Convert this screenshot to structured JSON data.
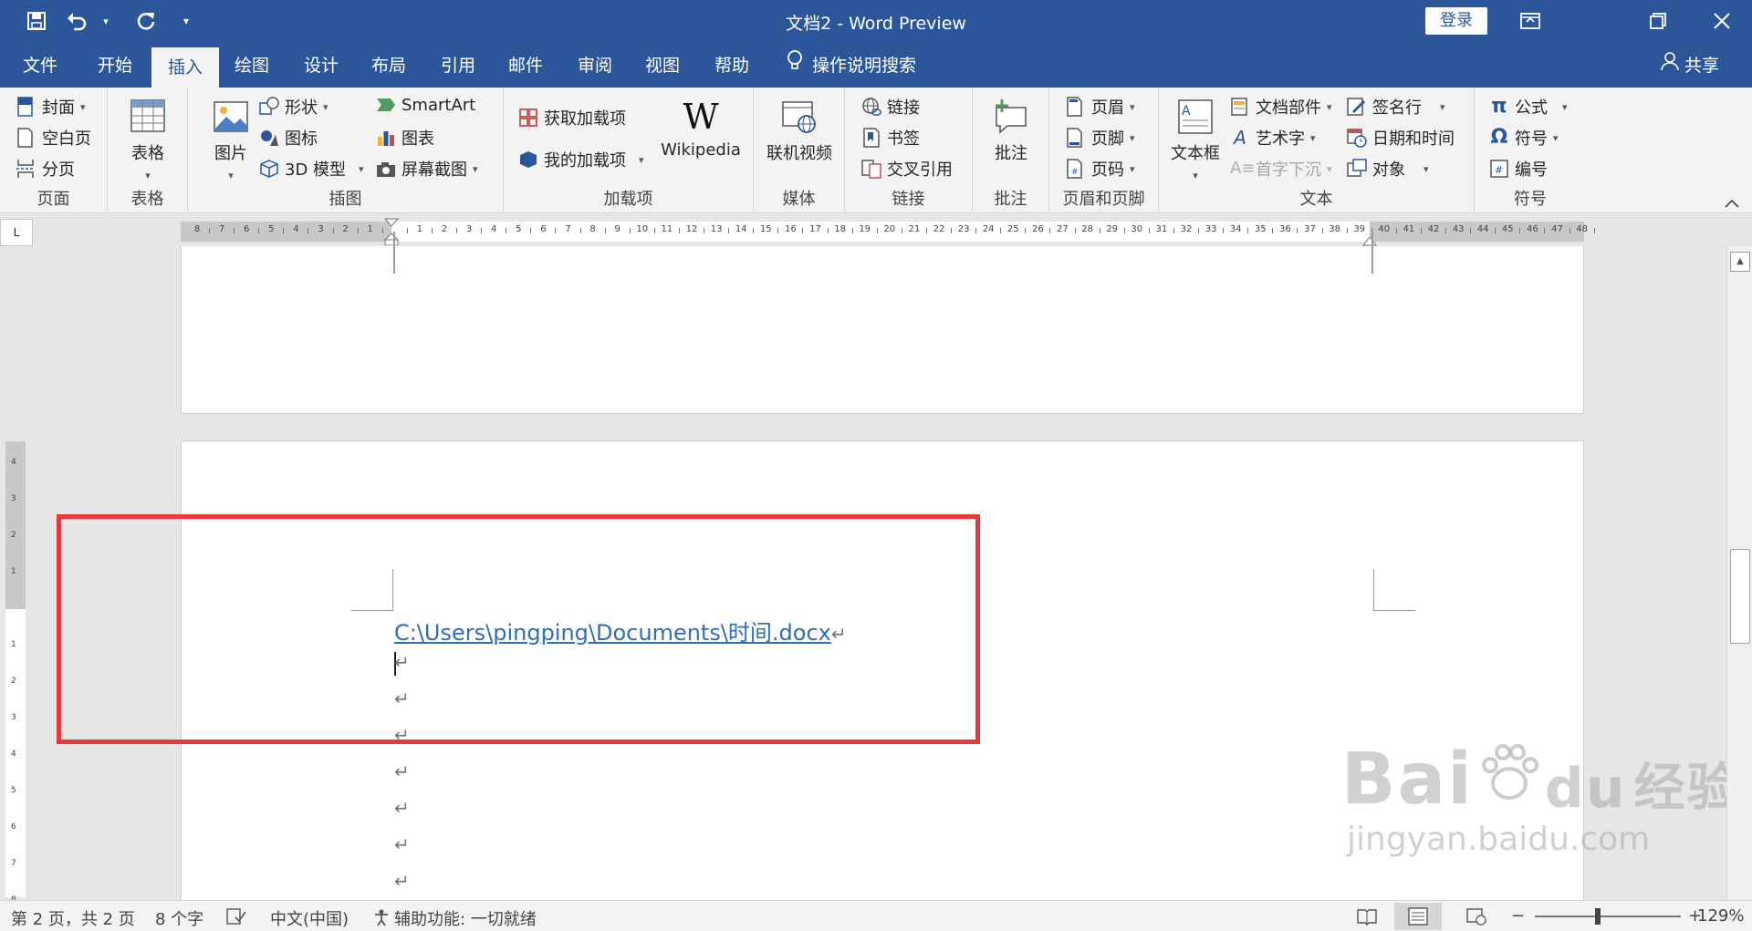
{
  "titlebar": {
    "title": "文档2  -  Word Preview",
    "login": "登录",
    "qat_more": "▾"
  },
  "tabs": [
    {
      "label": "文件"
    },
    {
      "label": "开始"
    },
    {
      "label": "插入",
      "active": true
    },
    {
      "label": "绘图"
    },
    {
      "label": "设计"
    },
    {
      "label": "布局"
    },
    {
      "label": "引用"
    },
    {
      "label": "邮件"
    },
    {
      "label": "审阅"
    },
    {
      "label": "视图"
    },
    {
      "label": "帮助"
    }
  ],
  "tell_me": "操作说明搜索",
  "share": "共享",
  "ribbon": {
    "pages": {
      "label": "页面",
      "cover": "封面",
      "blank": "空白页",
      "break": "分页"
    },
    "tables": {
      "label": "表格",
      "table": "表格"
    },
    "illustrations": {
      "label": "插图",
      "pictures": "图片",
      "shapes": "形状",
      "icons": "图标",
      "model3d": "3D 模型",
      "smartart": "SmartArt",
      "chart": "图表",
      "screenshot": "屏幕截图"
    },
    "addins": {
      "label": "加载项",
      "get": "获取加载项",
      "my": "我的加载项",
      "wikipedia": "Wikipedia"
    },
    "media": {
      "label": "媒体",
      "video": "联机视频"
    },
    "links": {
      "label": "链接",
      "link": "链接",
      "bookmark": "书签",
      "crossref": "交叉引用"
    },
    "comments": {
      "label": "批注",
      "comment": "批注"
    },
    "headerfooter": {
      "label": "页眉和页脚",
      "header": "页眉",
      "footer": "页脚",
      "pagenum": "页码"
    },
    "text": {
      "label": "文本",
      "textbox": "文本框",
      "quickparts": "文档部件",
      "wordart": "艺术字",
      "dropcap": "首字下沉",
      "sigline": "签名行",
      "datetime": "日期和时间",
      "object": "对象"
    },
    "symbols": {
      "label": "符号",
      "equation": "公式",
      "symbol": "符号",
      "number": "编号"
    }
  },
  "ruler": {
    "marks": [
      "8",
      "7",
      "6",
      "5",
      "4",
      "3",
      "2",
      "1",
      "",
      "1",
      "2",
      "3",
      "4",
      "5",
      "6",
      "7",
      "8",
      "9",
      "10",
      "11",
      "12",
      "13",
      "14",
      "15",
      "16",
      "17",
      "18",
      "19",
      "20",
      "21",
      "22",
      "23",
      "24",
      "25",
      "26",
      "27",
      "28",
      "29",
      "30",
      "31",
      "32",
      "33",
      "34",
      "35",
      "36",
      "37",
      "38",
      "39",
      "40",
      "41",
      "42",
      "43",
      "44",
      "45",
      "46",
      "47",
      "48"
    ],
    "corner": "L"
  },
  "document": {
    "link": "C:\\Users\\pingping\\Documents\\时间.docx",
    "para_mark": "↵"
  },
  "watermark": {
    "brand": "Bai",
    "brand2": "du",
    "cn": "经验",
    "url": "jingyan.baidu.com"
  },
  "statusbar": {
    "page": "第 2 页，共 2 页",
    "words": "8 个字",
    "lang": "中文(中国)",
    "access": "辅助功能: 一切就绪",
    "zoom": "129%",
    "minus": "−",
    "plus": "+"
  }
}
